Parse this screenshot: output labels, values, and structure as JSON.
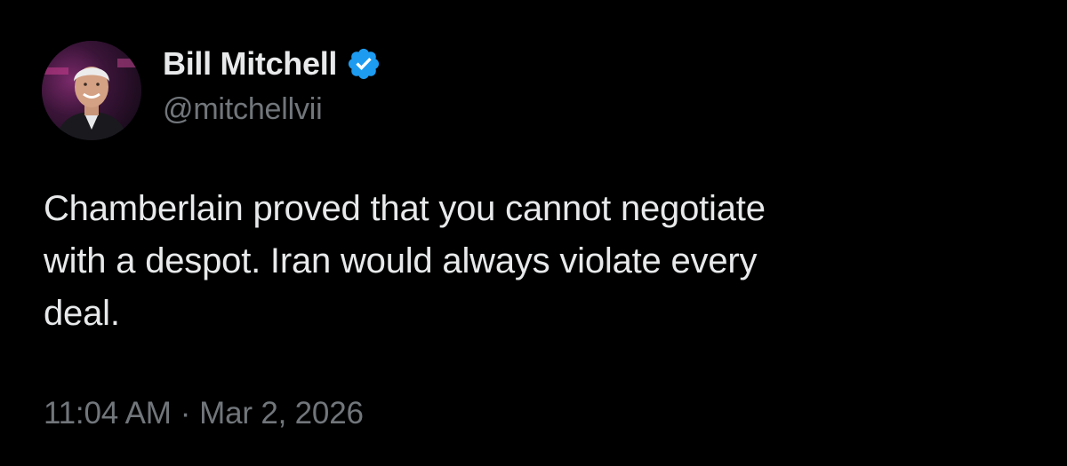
{
  "author": {
    "display_name": "Bill Mitchell",
    "handle": "@mitchellvii",
    "verified_icon": "verified-badge-icon",
    "avatar_icon": "avatar-photo"
  },
  "tweet": {
    "text_lines": [
      "Chamberlain proved that you cannot negotiate",
      "with a despot. Iran would always violate every",
      "deal."
    ]
  },
  "meta": {
    "time": "11:04 AM",
    "separator": "·",
    "date": "Mar 2, 2026"
  },
  "colors": {
    "background": "#000000",
    "text_primary": "#e7e9ea",
    "text_secondary": "#71767b",
    "verified_blue": "#1d9bf0"
  }
}
